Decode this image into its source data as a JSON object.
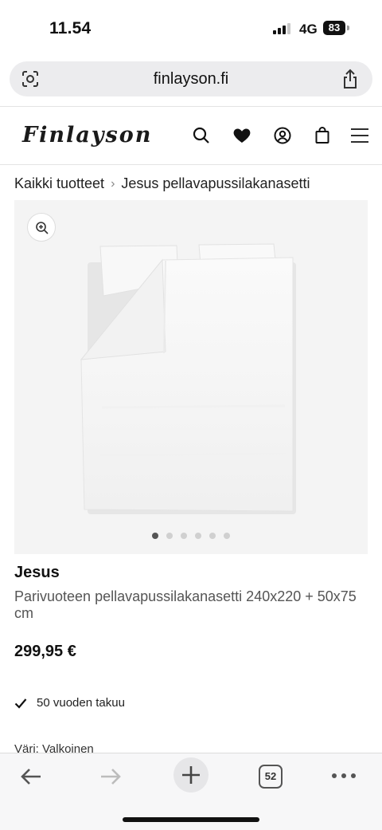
{
  "status": {
    "time": "11.54",
    "network": "4G",
    "battery": "83"
  },
  "browser": {
    "url": "finlayson.fi",
    "tab_count": "52"
  },
  "site": {
    "logo": "Finlayson"
  },
  "breadcrumb": {
    "root": "Kaikki tuotteet",
    "separator": "›",
    "current": "Jesus pellavapussilakanasetti"
  },
  "gallery": {
    "image_count": 6,
    "active_index": 0
  },
  "product": {
    "brand": "Jesus",
    "name": "Parivuoteen pellavapussilakanasetti 240x220 + 50x75 cm",
    "price": "299,95 €",
    "warranty": "50 vuoden takuu",
    "color_label": "Väri: Valkoinen"
  },
  "icons": {
    "url_left": "screen-capture-icon",
    "share": "share-icon",
    "search": "search-icon",
    "favorites": "heart-icon",
    "account": "user-icon",
    "cart": "bag-icon",
    "menu": "hamburger-icon",
    "zoom": "zoom-in-icon",
    "warranty": "checkmark-icon",
    "back": "arrow-left-icon",
    "forward": "arrow-right-icon",
    "new_tab": "plus-icon",
    "more": "more-icon"
  }
}
